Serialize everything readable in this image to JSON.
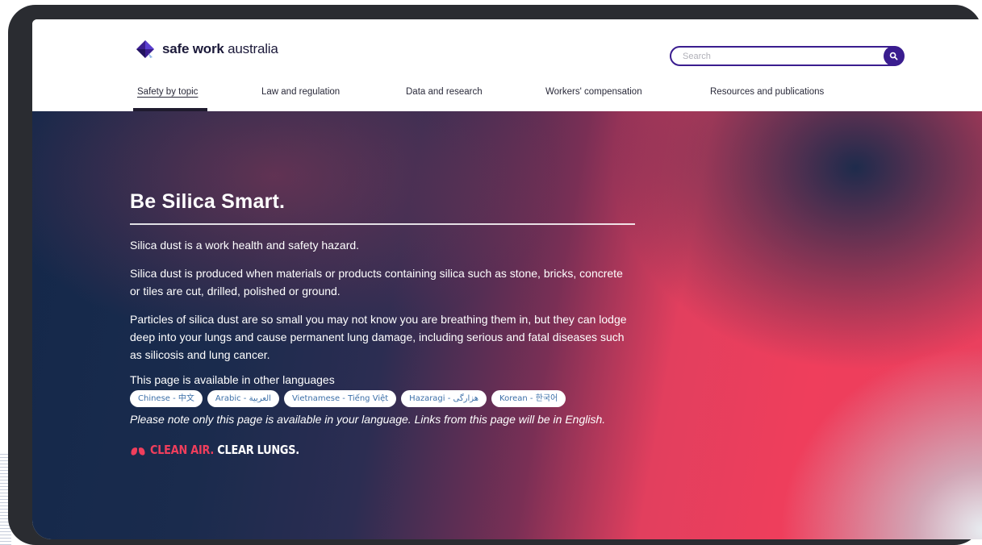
{
  "brand": {
    "name_bold": "safe work",
    "name_regular": " australia",
    "color_primary": "#3a1d8f",
    "color_accent": "#ef3e5c"
  },
  "search": {
    "placeholder": "Search",
    "icon": "search-icon"
  },
  "nav": {
    "items": [
      {
        "label": "Safety by topic",
        "active": true
      },
      {
        "label": "Law and regulation"
      },
      {
        "label": "Data and research"
      },
      {
        "label": "Workers' compensation"
      },
      {
        "label": "Resources and publications"
      }
    ]
  },
  "hero": {
    "title": "Be Silica Smart.",
    "paragraphs": [
      "Silica dust is a work health and safety hazard.",
      "Silica dust is produced when materials or products containing silica such as stone, bricks, concrete or tiles are cut, drilled, polished or ground.",
      "Particles of silica dust are so small you may not know you are breathing them in, but they can lodge deep into your lungs and cause permanent lung damage, including serious and fatal diseases such as silicosis and lung cancer."
    ],
    "languages_heading": "This page is available in other languages",
    "languages": [
      "Chinese - 中文",
      "Arabic - العربية",
      "Vietnamese - Tiếng Việt",
      "Hazaragi - هزارگی",
      "Korean - 한국어"
    ],
    "note": "Please note only this page is available in your language. Links from this page will be in English.",
    "campaign": {
      "part1": "CLEAN AIR.",
      "part2": " CLEAR LUNGS.",
      "icon": "lungs-icon"
    }
  }
}
